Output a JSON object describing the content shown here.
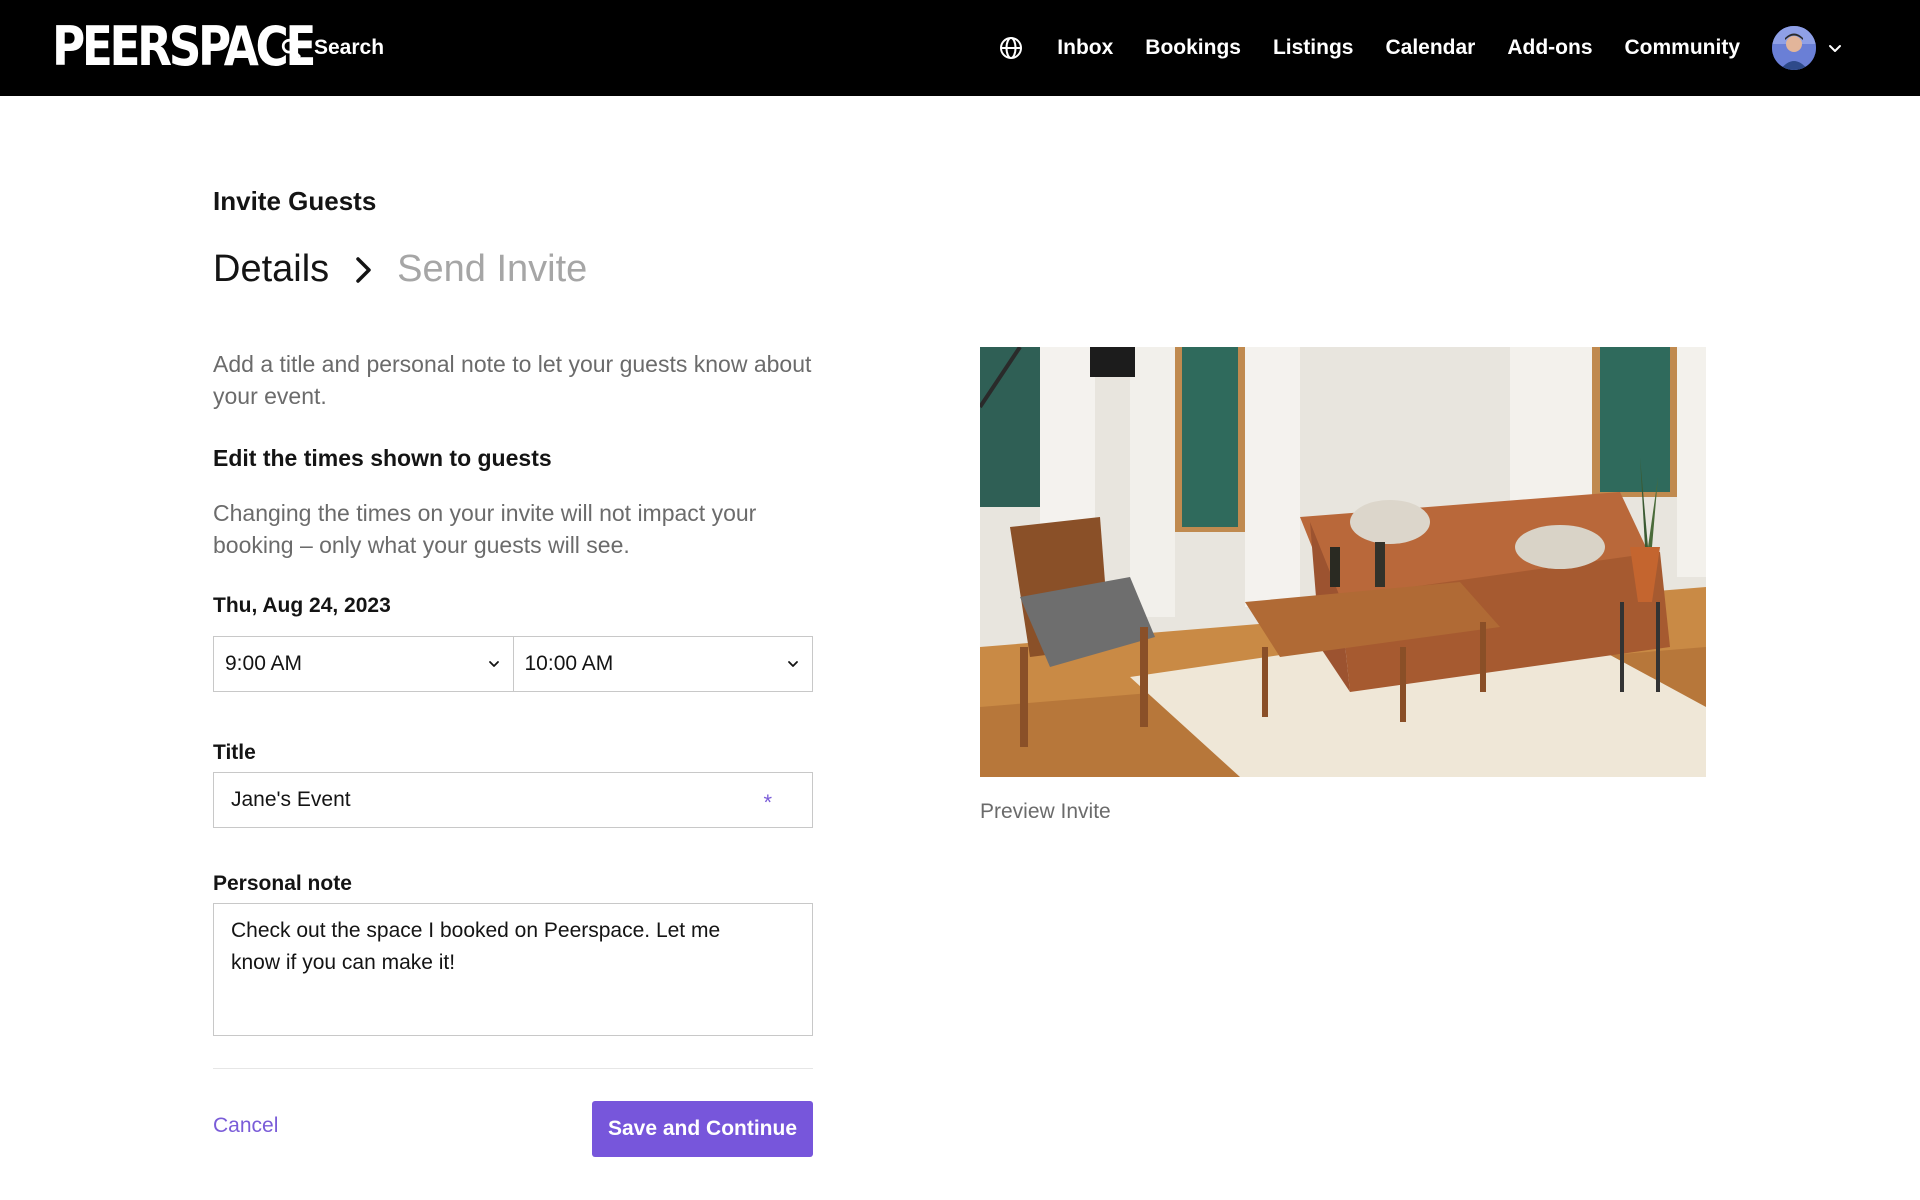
{
  "app": {
    "logo_text": "PEERSPACE"
  },
  "nav": {
    "search_label": "Search",
    "links": [
      "Inbox",
      "Bookings",
      "Listings",
      "Calendar",
      "Add-ons",
      "Community"
    ]
  },
  "page": {
    "title": "Invite Guests",
    "steps": {
      "current": "Details",
      "next": "Send Invite"
    },
    "intro": "Add a title and personal note to let your guests know about your event.",
    "times_heading": "Edit the times shown to guests",
    "times_description": "Changing the times on your invite will not impact your booking – only what your guests will see.",
    "date": "Thu, Aug 24, 2023",
    "start_time": "9:00 AM",
    "end_time": "10:00 AM",
    "title_label": "Title",
    "title_value": "Jane's Event",
    "required_marker": "*",
    "note_label": "Personal note",
    "note_value": "Check out the space I booked on Peerspace. Let me know if you can make it!",
    "cancel_label": "Cancel",
    "save_label": "Save and Continue"
  },
  "preview": {
    "caption": "Preview Invite"
  },
  "colors": {
    "nav_background": "#000000",
    "accent": "#7756db",
    "link": "#7a5cd8",
    "muted_text": "#6b6b6b",
    "inactive_step": "#a6a6a6",
    "border": "#c8c8c8"
  }
}
